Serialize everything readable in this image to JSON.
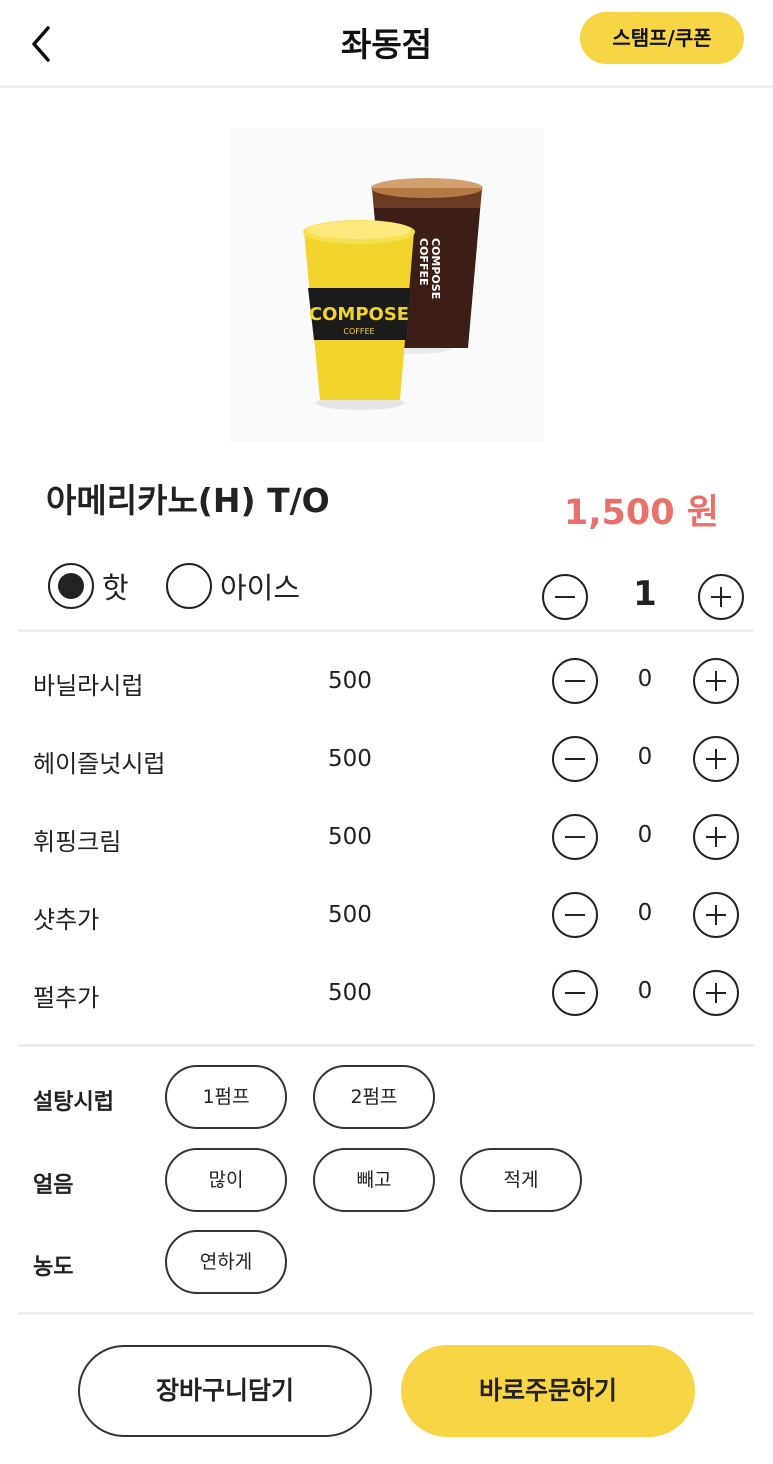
{
  "header": {
    "title": "좌동점",
    "stamp_coupon_label": "스탬프/쿠폰"
  },
  "product": {
    "name": "아메리카노(H) T/O",
    "price": "1,500 원",
    "image_brand_text": "COMPOSE COFFEE",
    "quantity": "1"
  },
  "temperature": {
    "options": [
      {
        "label": "핫",
        "selected": true
      },
      {
        "label": "아이스",
        "selected": false
      }
    ]
  },
  "extras": [
    {
      "name": "바닐라시럽",
      "price": "500",
      "qty": "0"
    },
    {
      "name": "헤이즐넛시럽",
      "price": "500",
      "qty": "0"
    },
    {
      "name": "휘핑크림",
      "price": "500",
      "qty": "0"
    },
    {
      "name": "샷추가",
      "price": "500",
      "qty": "0"
    },
    {
      "name": "펄추가",
      "price": "500",
      "qty": "0"
    }
  ],
  "choices": {
    "sugar": {
      "label": "설탕시럽",
      "options": [
        "1펌프",
        "2펌프"
      ]
    },
    "ice": {
      "label": "얼음",
      "options": [
        "많이",
        "빼고",
        "적게"
      ]
    },
    "strength": {
      "label": "농도",
      "options": [
        "연하게"
      ]
    }
  },
  "actions": {
    "cart_label": "장바구니담기",
    "order_label": "바로주문하기"
  },
  "colors": {
    "accent_yellow": "#f7d545",
    "price_red": "#e8716c"
  }
}
